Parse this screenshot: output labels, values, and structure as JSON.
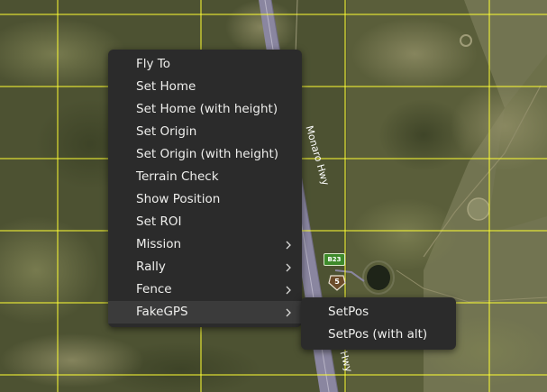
{
  "map": {
    "road_name": "Monaro Hwy",
    "road_name_partial": "Hwy",
    "route_shield_text": "B23",
    "route_marker_text": "5",
    "grid_color": "#ffff33",
    "road_color": "#8a86a0"
  },
  "context_menu": {
    "items": [
      {
        "label": "Fly To",
        "has_submenu": false
      },
      {
        "label": "Set Home",
        "has_submenu": false
      },
      {
        "label": "Set Home (with height)",
        "has_submenu": false
      },
      {
        "label": "Set Origin",
        "has_submenu": false
      },
      {
        "label": "Set Origin (with height)",
        "has_submenu": false
      },
      {
        "label": "Terrain Check",
        "has_submenu": false
      },
      {
        "label": "Show Position",
        "has_submenu": false
      },
      {
        "label": "Set ROI",
        "has_submenu": false
      },
      {
        "label": "Mission",
        "has_submenu": true
      },
      {
        "label": "Rally",
        "has_submenu": true
      },
      {
        "label": "Fence",
        "has_submenu": true
      },
      {
        "label": "FakeGPS",
        "has_submenu": true,
        "active": true
      }
    ],
    "chevron_icon": "chevron-right-icon"
  },
  "submenu": {
    "parent": "FakeGPS",
    "items": [
      {
        "label": "SetPos"
      },
      {
        "label": "SetPos (with alt)"
      }
    ]
  }
}
